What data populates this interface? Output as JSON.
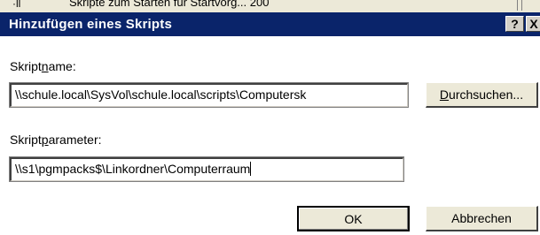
{
  "background_window": {
    "mark": "·ll",
    "partial_text": "Skripte zum Starten für Startvorg... 200"
  },
  "dialog": {
    "title": "Hinzufügen eines Skripts",
    "help_glyph": "?",
    "close_glyph": "X",
    "script_name": {
      "label_before": "Skript",
      "label_accel": "n",
      "label_after": "ame:",
      "value": "\\\\schule.local\\SysVol\\schule.local\\scripts\\Computersk"
    },
    "browse_button": {
      "accel": "D",
      "rest": "urchsuchen..."
    },
    "script_params": {
      "label_before": "Skript",
      "label_accel": "p",
      "label_after": "arameter:",
      "value": "\\\\s1\\pgmpacks$\\Linkordner\\Computerraum"
    },
    "ok_label": "OK",
    "cancel_label": "Abbrechen"
  },
  "colors": {
    "titlebar": "#0a246a",
    "button_face": "#ece9d8"
  }
}
